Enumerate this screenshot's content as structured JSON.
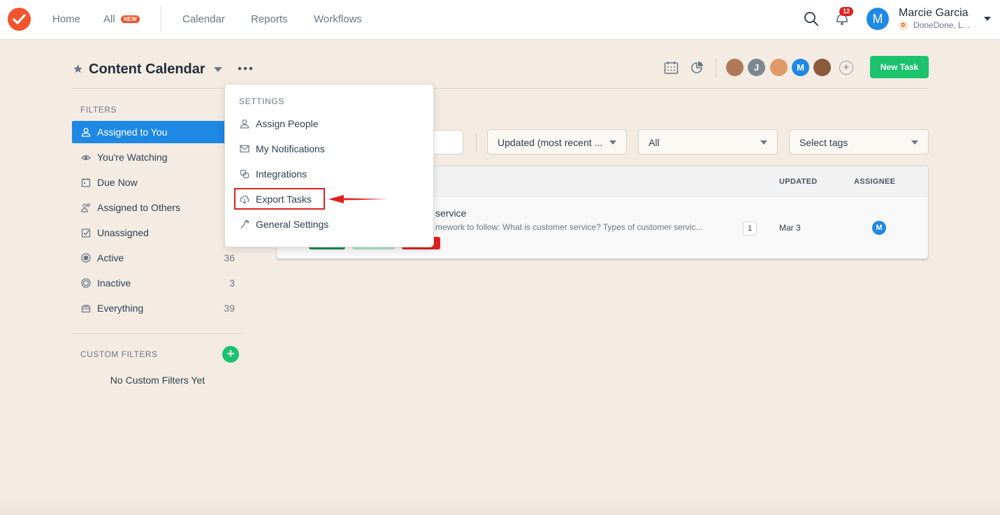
{
  "topnav": {
    "logo": "checkmark-logo",
    "links": [
      "Home",
      "All",
      "Calendar",
      "Reports",
      "Workflows"
    ],
    "new_badge": "NEW",
    "notification_count": "12",
    "user": {
      "initial": "M",
      "name": "Marcie Garcia",
      "org_initial": "D",
      "org": "DoneDone, L..."
    }
  },
  "header": {
    "title": "Content Calendar",
    "new_task_label": "New Task",
    "avatars": [
      {
        "initial": "",
        "color": "#b07a5a"
      },
      {
        "initial": "J",
        "color": "#7d8790"
      },
      {
        "initial": "",
        "color": "#e09a6a"
      },
      {
        "initial": "M",
        "color": "#1e88e5"
      },
      {
        "initial": "",
        "color": "#8a5a3a"
      }
    ],
    "add_people": "+"
  },
  "sidebar": {
    "filters_heading": "FILTERS",
    "items": [
      {
        "label": "Assigned to You",
        "count": "",
        "active": true,
        "icon": "person-icon"
      },
      {
        "label": "You're Watching",
        "count": "",
        "active": false,
        "icon": "eye-icon"
      },
      {
        "label": "Due Now",
        "count": "",
        "active": false,
        "icon": "calendar-icon"
      },
      {
        "label": "Assigned to Others",
        "count": "",
        "active": false,
        "icon": "people-icon"
      },
      {
        "label": "Unassigned",
        "count": "",
        "active": false,
        "icon": "checkbox-icon"
      },
      {
        "label": "Active",
        "count": "36",
        "active": false,
        "icon": "radio-on-icon"
      },
      {
        "label": "Inactive",
        "count": "3",
        "active": false,
        "icon": "radio-off-icon"
      },
      {
        "label": "Everything",
        "count": "39",
        "active": false,
        "icon": "stack-icon"
      }
    ],
    "custom_heading": "CUSTOM FILTERS",
    "add_custom": "+",
    "no_custom": "No Custom Filters Yet"
  },
  "toolbar": {
    "sort_value": "Updated (most recent ...",
    "status_value": "All",
    "tags_value": "Select tags"
  },
  "table": {
    "headers": {
      "updated": "UPDATED",
      "assignee": "ASSIGNEE"
    },
    "row": {
      "title": "service",
      "desc": "mework to follow: What is customer service? Types of customer servic...",
      "comments": "1",
      "updated": "Mar 3",
      "assignee_initial": "M",
      "tag_colors": [
        "#1a8a5e",
        "#a8e4cb",
        "#e02020"
      ]
    }
  },
  "menu": {
    "heading": "SETTINGS",
    "items": [
      {
        "label": "Assign People",
        "icon": "person-icon"
      },
      {
        "label": "My Notifications",
        "icon": "envelope-icon"
      },
      {
        "label": "Integrations",
        "icon": "integrations-icon"
      },
      {
        "label": "Export Tasks",
        "icon": "cloud-download-icon"
      },
      {
        "label": "General Settings",
        "icon": "wrench-icon"
      }
    ]
  },
  "colors": {
    "accent": "#1e88e5",
    "brand": "#f2542d",
    "success": "#1cc26d",
    "annotation": "#e02020"
  }
}
